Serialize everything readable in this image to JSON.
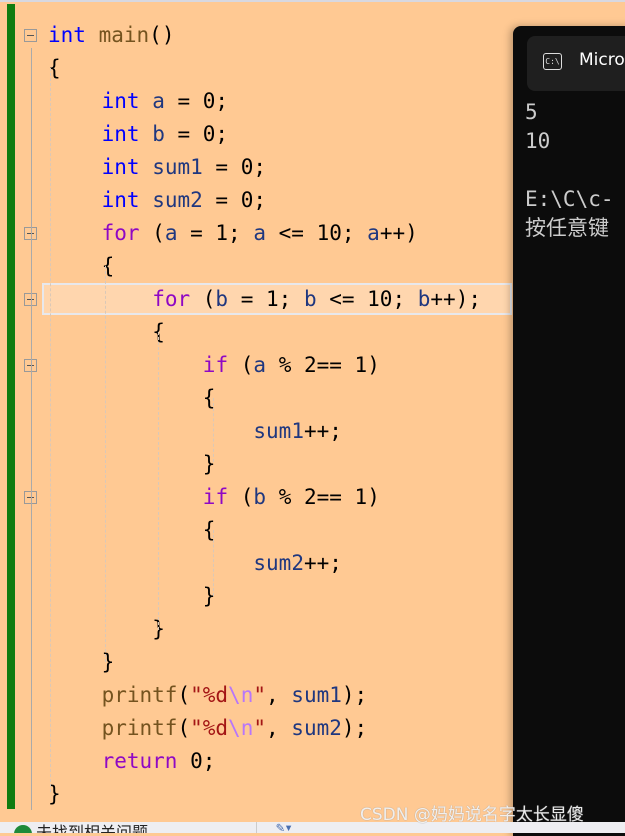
{
  "editor": {
    "highlighted_line": 8,
    "lines": [
      {
        "indent": 0,
        "tokens": [
          [
            "int",
            "kw"
          ],
          [
            " ",
            ""
          ],
          [
            "main",
            "fn"
          ],
          [
            "()",
            ""
          ]
        ]
      },
      {
        "indent": 0,
        "tokens": [
          [
            "{",
            ""
          ]
        ]
      },
      {
        "indent": 1,
        "tokens": [
          [
            "int",
            "kw"
          ],
          [
            " ",
            ""
          ],
          [
            "a",
            "var"
          ],
          [
            " = 0;",
            ""
          ]
        ]
      },
      {
        "indent": 1,
        "tokens": [
          [
            "int",
            "kw"
          ],
          [
            " ",
            ""
          ],
          [
            "b",
            "var"
          ],
          [
            " = 0;",
            ""
          ]
        ]
      },
      {
        "indent": 1,
        "tokens": [
          [
            "int",
            "kw"
          ],
          [
            " ",
            ""
          ],
          [
            "sum1",
            "var"
          ],
          [
            " = 0;",
            ""
          ]
        ]
      },
      {
        "indent": 1,
        "tokens": [
          [
            "int",
            "kw"
          ],
          [
            " ",
            ""
          ],
          [
            "sum2",
            "var"
          ],
          [
            " = 0;",
            ""
          ]
        ]
      },
      {
        "indent": 1,
        "tokens": [
          [
            "for",
            "ctl"
          ],
          [
            " (",
            ""
          ],
          [
            "a",
            "var"
          ],
          [
            " = 1; ",
            ""
          ],
          [
            "a",
            "var"
          ],
          [
            " <= 10; ",
            ""
          ],
          [
            "a",
            "var"
          ],
          [
            "++)",
            ""
          ]
        ]
      },
      {
        "indent": 1,
        "tokens": [
          [
            "{",
            ""
          ]
        ]
      },
      {
        "indent": 2,
        "tokens": [
          [
            "for",
            "ctl"
          ],
          [
            " (",
            ""
          ],
          [
            "b",
            "var"
          ],
          [
            " = 1; ",
            ""
          ],
          [
            "b",
            "var"
          ],
          [
            " <= 10; ",
            ""
          ],
          [
            "b",
            "var"
          ],
          [
            "++);",
            ""
          ]
        ]
      },
      {
        "indent": 2,
        "tokens": [
          [
            "{",
            ""
          ]
        ]
      },
      {
        "indent": 3,
        "tokens": [
          [
            "if",
            "ctl"
          ],
          [
            " (",
            ""
          ],
          [
            "a",
            "var"
          ],
          [
            " % 2== 1)",
            ""
          ]
        ]
      },
      {
        "indent": 3,
        "tokens": [
          [
            "{",
            ""
          ]
        ]
      },
      {
        "indent": 4,
        "tokens": [
          [
            "sum1",
            "var"
          ],
          [
            "++;",
            ""
          ]
        ]
      },
      {
        "indent": 3,
        "tokens": [
          [
            "}",
            ""
          ]
        ]
      },
      {
        "indent": 3,
        "tokens": [
          [
            "if",
            "ctl"
          ],
          [
            " (",
            ""
          ],
          [
            "b",
            "var"
          ],
          [
            " % 2== 1)",
            ""
          ]
        ]
      },
      {
        "indent": 3,
        "tokens": [
          [
            "{",
            ""
          ]
        ]
      },
      {
        "indent": 4,
        "tokens": [
          [
            "sum2",
            "var"
          ],
          [
            "++;",
            ""
          ]
        ]
      },
      {
        "indent": 3,
        "tokens": [
          [
            "}",
            ""
          ]
        ]
      },
      {
        "indent": 2,
        "tokens": [
          [
            "}",
            ""
          ]
        ]
      },
      {
        "indent": 1,
        "tokens": [
          [
            "}",
            ""
          ]
        ]
      },
      {
        "indent": 1,
        "tokens": [
          [
            "printf",
            "fn"
          ],
          [
            "(",
            ""
          ],
          [
            "\"%d",
            "str"
          ],
          [
            "\\n",
            "esc"
          ],
          [
            "\"",
            "str"
          ],
          [
            ", ",
            ""
          ],
          [
            "sum1",
            "var"
          ],
          [
            ");",
            ""
          ]
        ]
      },
      {
        "indent": 1,
        "tokens": [
          [
            "printf",
            "fn"
          ],
          [
            "(",
            ""
          ],
          [
            "\"%d",
            "str"
          ],
          [
            "\\n",
            "esc"
          ],
          [
            "\"",
            "str"
          ],
          [
            ", ",
            ""
          ],
          [
            "sum2",
            "var"
          ],
          [
            ");",
            ""
          ]
        ]
      },
      {
        "indent": 1,
        "tokens": [
          [
            "return",
            "ctl"
          ],
          [
            " 0;",
            ""
          ]
        ]
      },
      {
        "indent": 0,
        "tokens": [
          [
            "}",
            ""
          ]
        ]
      }
    ],
    "fold_lines": [
      0,
      6,
      8,
      10,
      14
    ]
  },
  "terminal": {
    "icon": "C:\\",
    "title": "Micro",
    "output": [
      "5",
      "10",
      "",
      "E:\\C\\c-",
      "按任意键"
    ]
  },
  "status": {
    "message": "未找到相关问题",
    "icon": "check-circle-icon"
  },
  "watermark": "CSDN @妈妈说名字太长显傻",
  "colors": {
    "editor_bg": "#ffc993",
    "keyword": "#0000ff",
    "control": "#8f08c4",
    "function": "#74531f",
    "variable": "#1f377f",
    "string": "#a31515",
    "terminal_bg": "#0c0c0c",
    "change_bar": "#107c10"
  }
}
